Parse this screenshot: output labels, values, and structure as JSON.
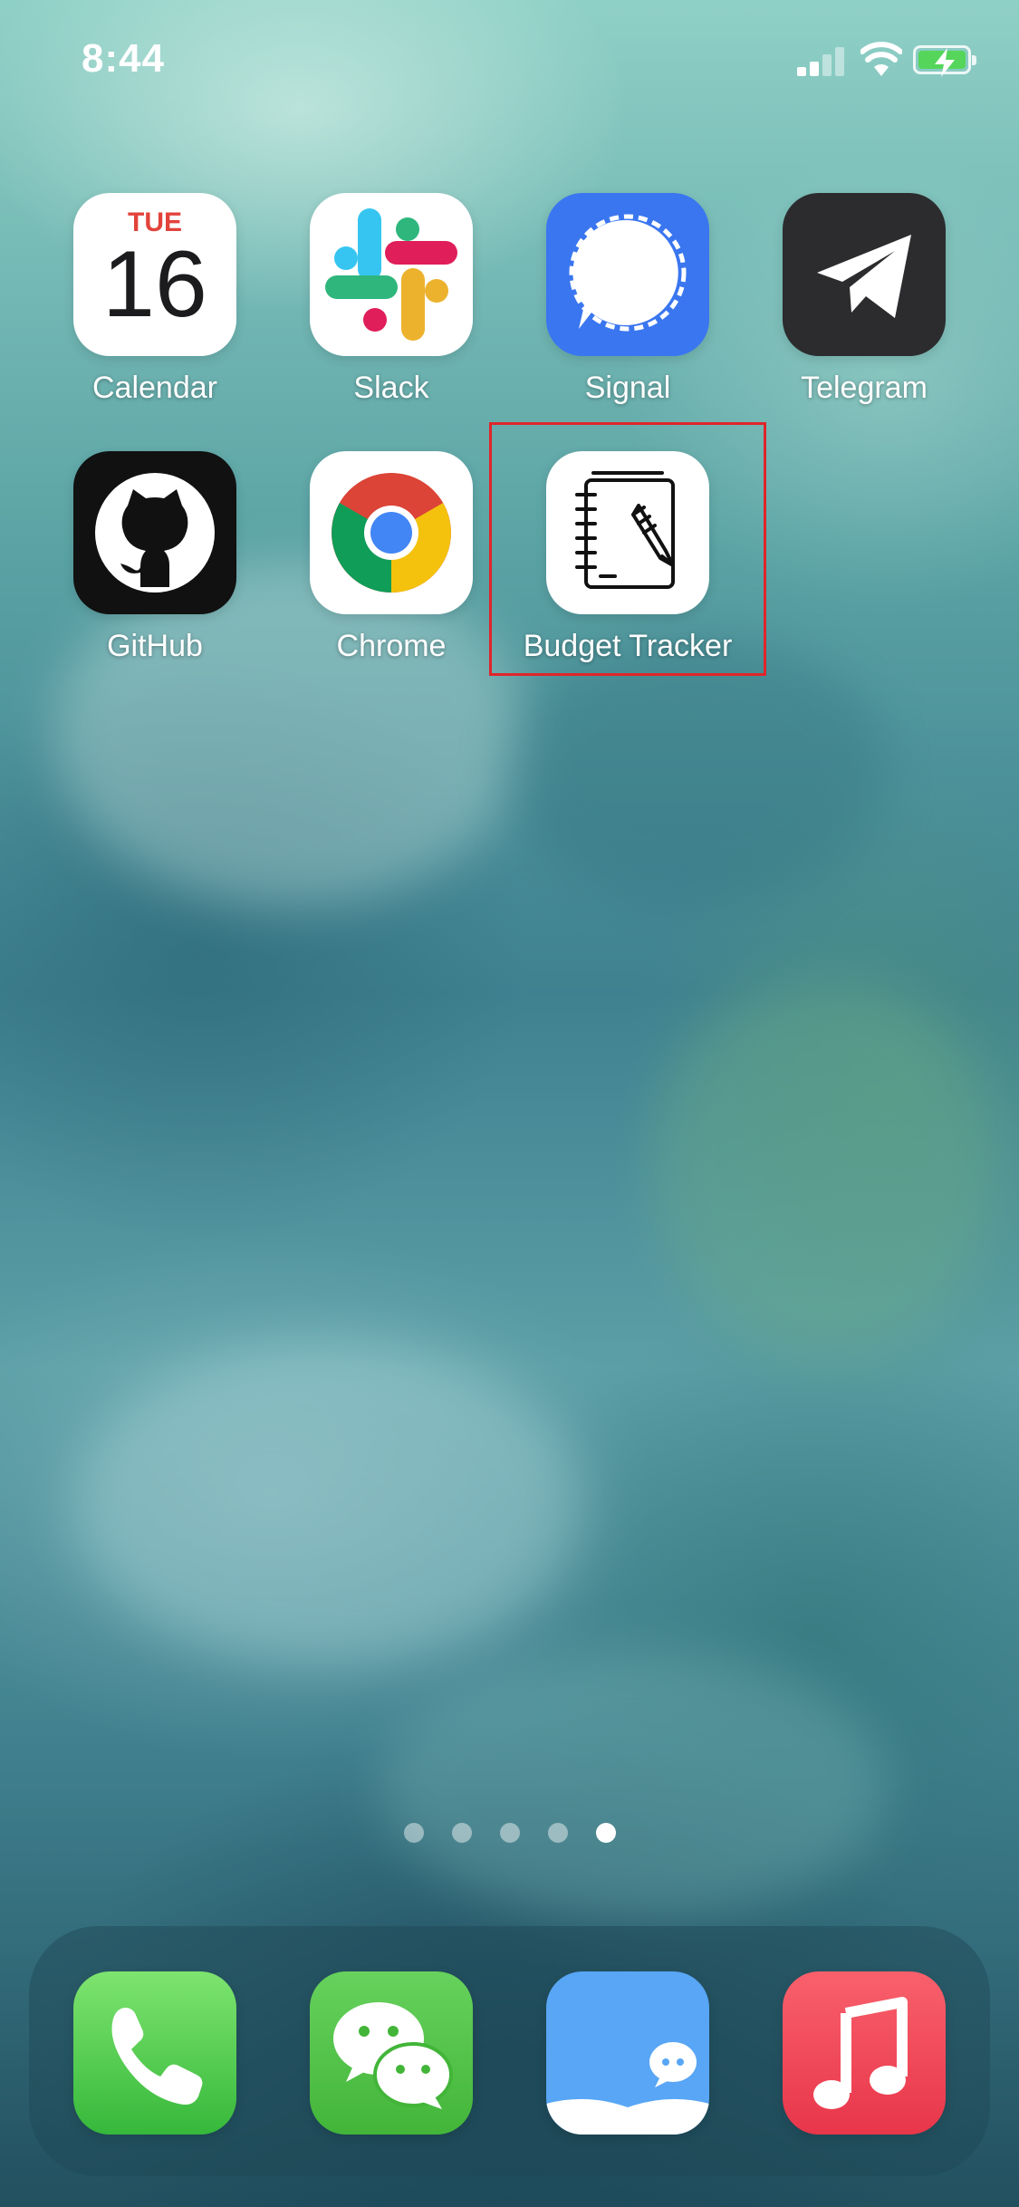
{
  "status_bar": {
    "time": "8:44"
  },
  "apps": [
    {
      "name": "calendar",
      "label": "Calendar",
      "day": "TUE",
      "date": "16"
    },
    {
      "name": "slack",
      "label": "Slack"
    },
    {
      "name": "signal",
      "label": "Signal"
    },
    {
      "name": "telegram",
      "label": "Telegram"
    },
    {
      "name": "github",
      "label": "GitHub"
    },
    {
      "name": "chrome",
      "label": "Chrome"
    },
    {
      "name": "budget-tracker",
      "label": "Budget Tracker"
    }
  ],
  "page_indicator": {
    "count": 5,
    "active": 5
  },
  "dock": [
    {
      "name": "phone",
      "icon": "phone-icon"
    },
    {
      "name": "wechat",
      "icon": "wechat-icon"
    },
    {
      "name": "books",
      "icon": "book-chat-icon"
    },
    {
      "name": "music",
      "icon": "music-note-icon"
    }
  ],
  "colors": {
    "calendar_red": "#e2433b",
    "signal_blue": "#3a76f0",
    "telegram_dark": "#2c2c2e",
    "phone_green": "#4cd964",
    "wechat_green": "#55c14e",
    "books_blue": "#58a6f5",
    "music_red": "#ef4654",
    "highlight_red": "#e0252a"
  }
}
